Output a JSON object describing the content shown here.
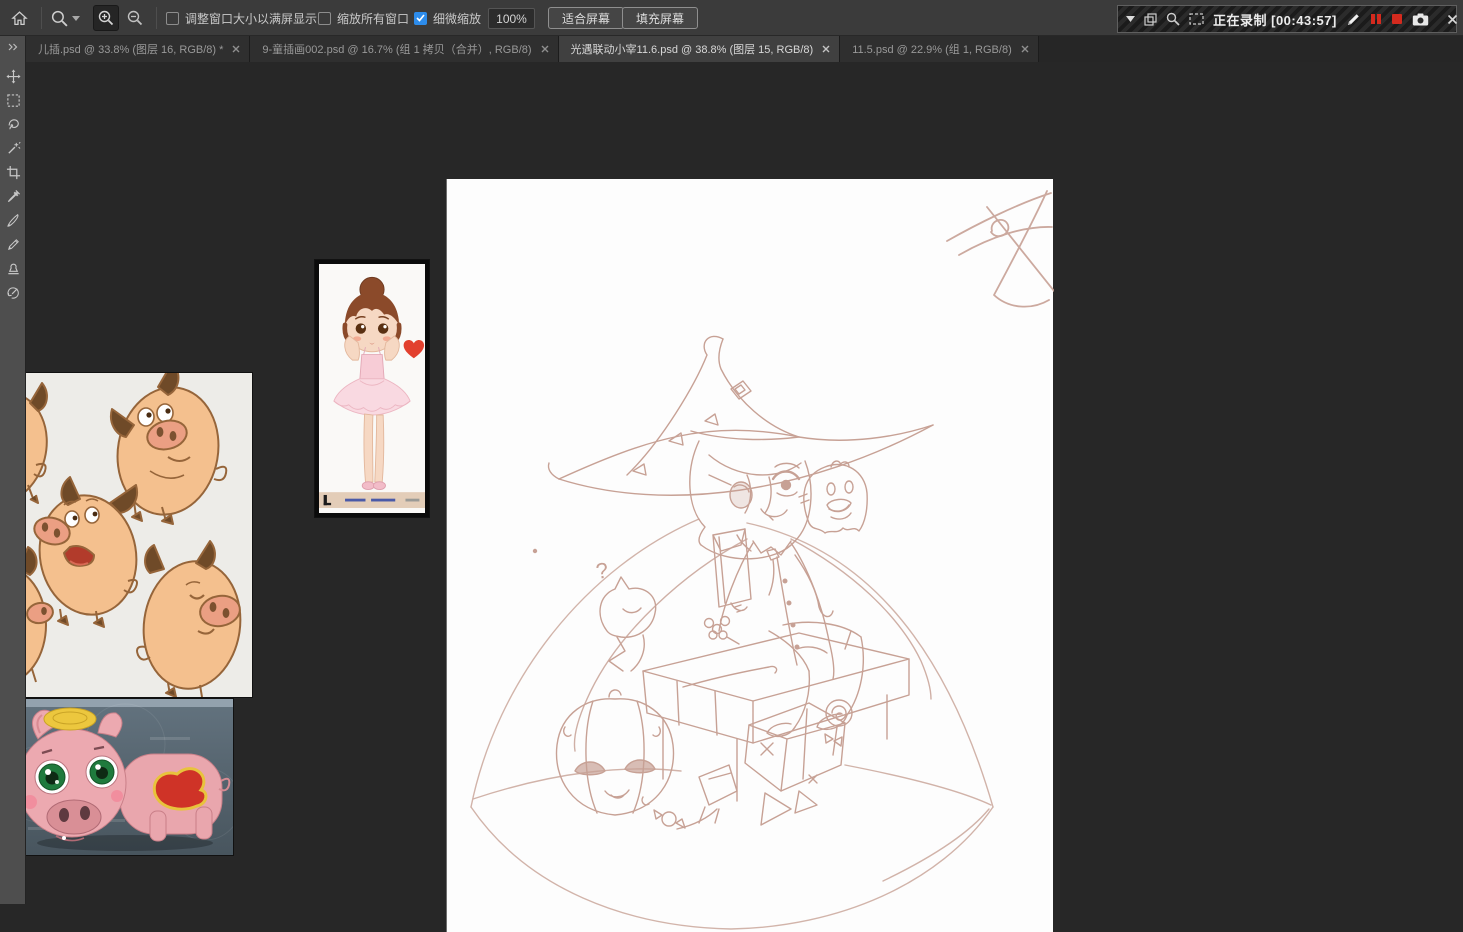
{
  "colors": {
    "accent_blue": "#2d8ceb",
    "recording_red": "#d42a1e",
    "sketch_line": "#c7a195",
    "canvas_white": "#fdfdfd"
  },
  "options_bar": {
    "resize_windows_label": "调整窗口大小以满屏显示",
    "zoom_all_windows_label": "缩放所有窗口",
    "scrubby_zoom_label": "细微缩放",
    "zoom_value": "100%",
    "fit_screen_label": "适合屏幕",
    "fill_screen_label": "填充屏幕"
  },
  "recorder": {
    "status_text": "正在录制 [00:43:57]"
  },
  "tab_bar": {
    "tabs": [
      {
        "label": "儿插.psd @ 33.8% (图层 16, RGB/8) *"
      },
      {
        "label": "9-童插画002.psd @ 16.7% (组 1 拷贝（合并）, RGB/8)"
      },
      {
        "label": "光遇联动小宰11.6.psd @ 38.8% (图层 15, RGB/8)"
      },
      {
        "label": "11.5.psd @ 22.9% (组 1, RGB/8)"
      }
    ]
  },
  "toolbar": {
    "tools": [
      "move",
      "rectangular-marquee",
      "lasso",
      "quick-selection",
      "crop",
      "eyedropper",
      "brush",
      "pencil",
      "clone-stamp",
      "history-brush"
    ]
  },
  "canvas_sketch": {
    "question_mark": "?"
  }
}
